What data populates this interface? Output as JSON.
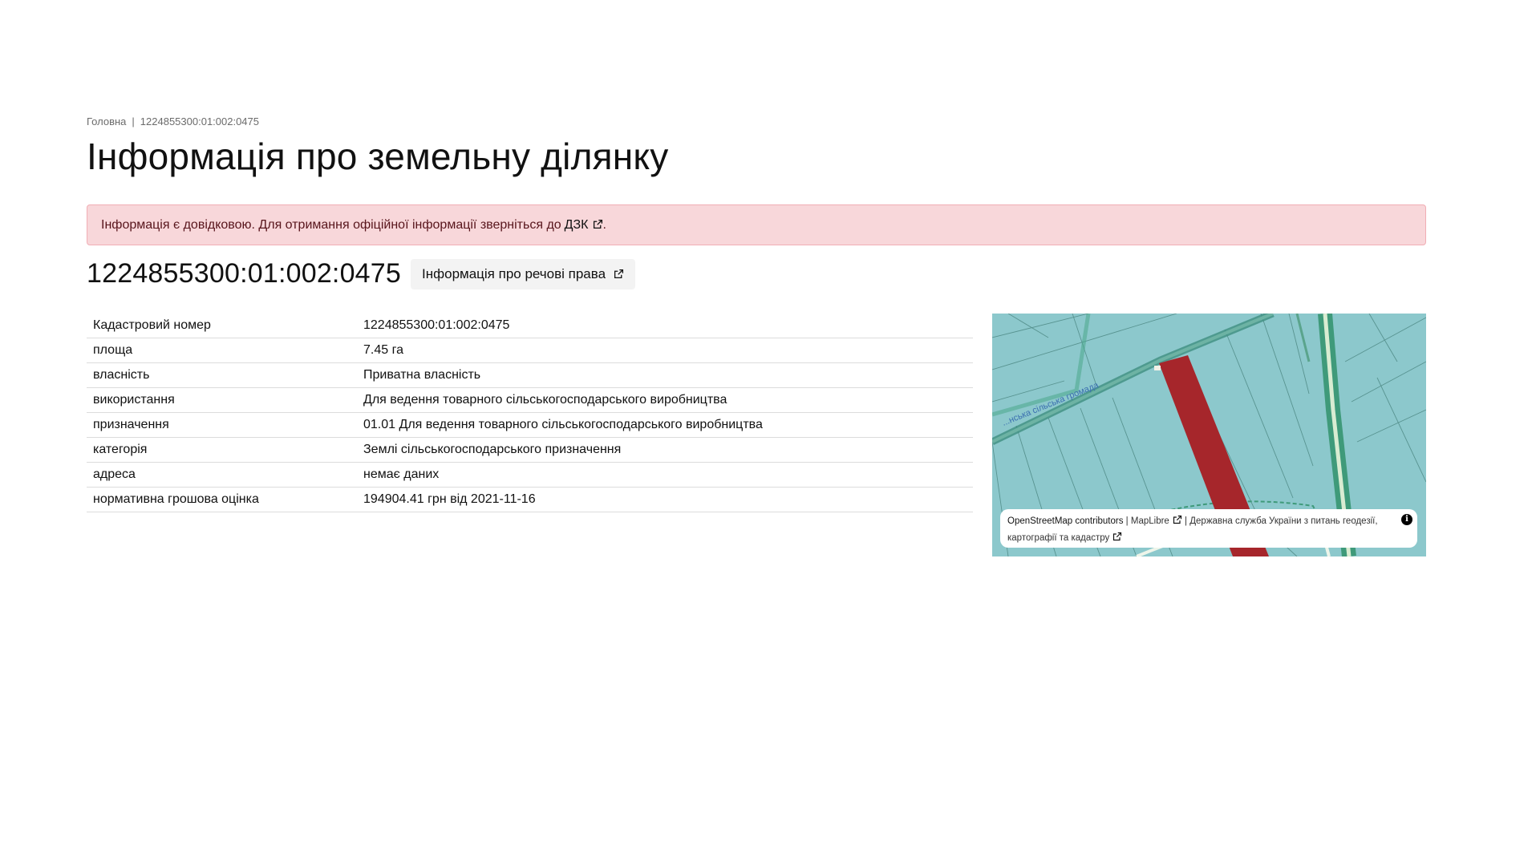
{
  "breadcrumb": {
    "home": "Головна",
    "separator": "|",
    "current": "1224855300:01:002:0475"
  },
  "page_title": "Інформація про земельну ділянку",
  "alert": {
    "text": "Інформація є довідковою. Для отримання офіційної інформації зверніться до",
    "link": "ДЗК",
    "suffix": "."
  },
  "parcel": {
    "number": "1224855300:01:002:0475",
    "rights_button": "Інформація про речові права"
  },
  "details": [
    {
      "key": "Кадастровий номер",
      "value": "1224855300:01:002:0475"
    },
    {
      "key": "площа",
      "value": "7.45 га"
    },
    {
      "key": "власність",
      "value": "Приватна власність"
    },
    {
      "key": "використання",
      "value": "Для ведення товарного сільськогосподарського виробництва"
    },
    {
      "key": "призначення",
      "value": "01.01 Для ведення товарного сільськогосподарського виробництва"
    },
    {
      "key": "категорія",
      "value": "Землі сільськогосподарського призначення"
    },
    {
      "key": "адреса",
      "value": "немає даних"
    },
    {
      "key": "нормативна грошова оцінка",
      "value": "194904.41 грн від 2021-11-16"
    }
  ],
  "map": {
    "boundary_label": "...нська сільська громада",
    "attribution": {
      "osm": "OpenStreetMap contributors",
      "sep1": "|",
      "maplibre": "MapLibre",
      "sep2": "|",
      "agency": "Державна служба України з питань геодезії, картографії та кадастру"
    },
    "info_symbol": "i",
    "colors": {
      "background": "#8cc8cc",
      "parcel_highlight": "#a6262b",
      "road": "#4aa88a"
    }
  },
  "colors": {
    "alert_bg": "#f8d7da",
    "alert_text": "#58151c"
  }
}
